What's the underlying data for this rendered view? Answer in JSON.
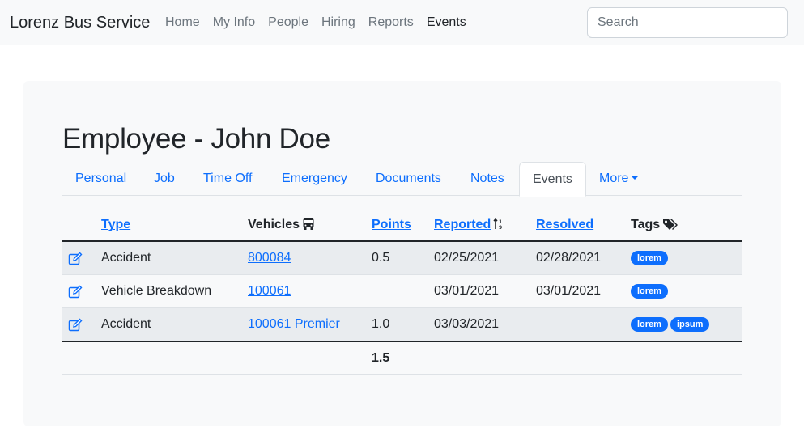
{
  "navbar": {
    "brand": "Lorenz Bus Service",
    "links": [
      "Home",
      "My Info",
      "People",
      "Hiring",
      "Reports",
      "Events"
    ],
    "active": "Events",
    "search_placeholder": "Search"
  },
  "page": {
    "title": "Employee - John Doe"
  },
  "tabs": [
    "Personal",
    "Job",
    "Time Off",
    "Emergency",
    "Documents",
    "Notes",
    "Events",
    "More"
  ],
  "active_tab": "Events",
  "table": {
    "headers": {
      "type": "Type",
      "vehicles": "Vehicles",
      "points": "Points",
      "reported": "Reported",
      "resolved": "Resolved",
      "tags": "Tags"
    },
    "rows": [
      {
        "type": "Accident",
        "vehicles": [
          "800084"
        ],
        "points": "0.5",
        "reported": "02/25/2021",
        "resolved": "02/28/2021",
        "tags": [
          "lorem"
        ]
      },
      {
        "type": "Vehicle Breakdown",
        "vehicles": [
          "100061"
        ],
        "points": "",
        "reported": "03/01/2021",
        "resolved": "03/01/2021",
        "tags": [
          "lorem"
        ]
      },
      {
        "type": "Accident",
        "vehicles": [
          "100061",
          "Premier"
        ],
        "points": "1.0",
        "reported": "03/03/2021",
        "resolved": "",
        "tags": [
          "lorem",
          "ipsum"
        ]
      }
    ],
    "total_points": "1.5"
  },
  "colors": {
    "link": "#0d6efd",
    "badge": "#0d6efd",
    "card_bg": "#f8f9fa",
    "stripe": "#e9ecef"
  },
  "icons": {
    "edit": "edit-icon",
    "vehicles": "bus-icon",
    "sort": "sort-icon",
    "tags": "tags-icon"
  }
}
